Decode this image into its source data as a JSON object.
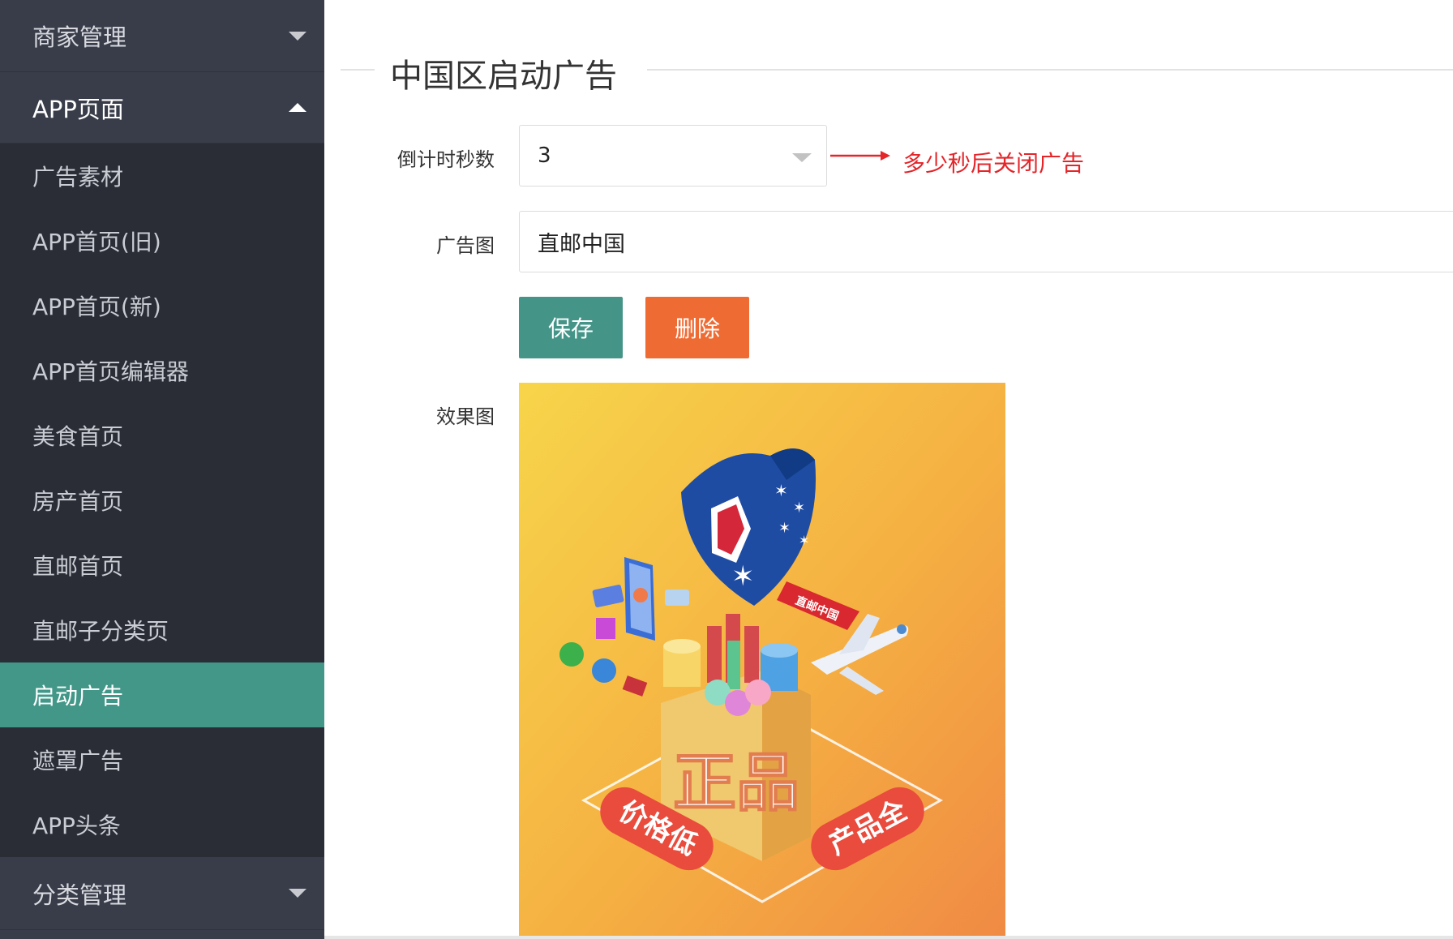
{
  "sidebar": {
    "groups": [
      {
        "label": "商家管理"
      },
      {
        "label": "APP页面"
      },
      {
        "label": "分类管理"
      }
    ],
    "app_items": [
      {
        "label": "广告素材"
      },
      {
        "label": "APP首页(旧)"
      },
      {
        "label": "APP首页(新)"
      },
      {
        "label": "APP首页编辑器"
      },
      {
        "label": "美食首页"
      },
      {
        "label": "房产首页"
      },
      {
        "label": "直邮首页"
      },
      {
        "label": "直邮子分类页"
      },
      {
        "label": "启动广告"
      },
      {
        "label": "遮罩广告"
      },
      {
        "label": "APP头条"
      }
    ]
  },
  "main": {
    "title": "中国区启动广告",
    "countdown": {
      "label": "倒计时秒数",
      "value": "3"
    },
    "annotation": "多少秒后关闭广告",
    "ad_image": {
      "label": "广告图",
      "value": "直邮中国"
    },
    "save_label": "保存",
    "delete_label": "删除",
    "preview": {
      "label": "效果图",
      "banner_text": "直邮中国",
      "left_badge": "价格低",
      "right_badge": "产品全",
      "cube_text": "正品"
    }
  },
  "colors": {
    "sidebar_bg": "#393d49",
    "submenu_bg": "#2a2d36",
    "active": "#429788",
    "save": "#449588",
    "delete": "#ef6b34",
    "annotation": "#e4252a"
  }
}
